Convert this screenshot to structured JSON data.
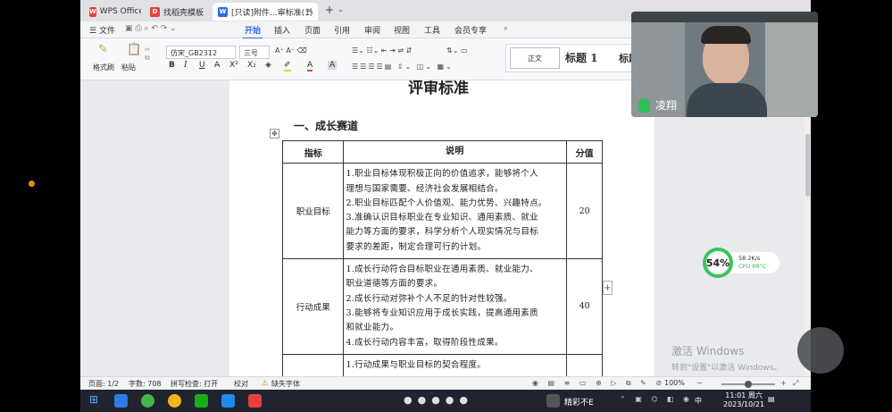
{
  "tabs": [
    {
      "label": "WPS Office",
      "icon": "wps-icon"
    },
    {
      "label": "找稻壳模板",
      "icon": "docer-icon"
    },
    {
      "label": "[只读]附件...审标准(1)",
      "icon": "word-doc-icon"
    }
  ],
  "add_tab": "+",
  "menu": {
    "file": "文件",
    "items": [
      "开始",
      "插入",
      "页面",
      "引用",
      "审阅",
      "视图",
      "工具",
      "会员专享"
    ],
    "active": "开始"
  },
  "ribbon": {
    "format_painter": "格式刷",
    "paste": "粘贴",
    "font_name": "仿宋_GB2312",
    "font_size": "三号",
    "styles": {
      "normal": "正文",
      "heading1": "标题 1",
      "heading2": "标题"
    }
  },
  "document": {
    "title": "评审标准",
    "section": "一、成长赛道",
    "table": {
      "headers": [
        "指标",
        "说明",
        "分值"
      ],
      "rows": [
        {
          "indicator": "职业目标",
          "lines": [
            "1.职业目标体现积极正向的价值追求，能够将个人",
            "理想与国家需要、经济社会发展相结合。",
            "2.职业目标匹配个人价值观、能力优势、兴趣特点。",
            "3.准确认识目标职业在专业知识、通用素质、就业",
            "能力等方面的要求，科学分析个人现实情况与目标",
            "要求的差距，制定合理可行的计划。"
          ],
          "score": "20"
        },
        {
          "indicator": "行动成果",
          "lines": [
            "1.成长行动符合目标职业在通用素质、就业能力、",
            "职业道德等方面的要求。",
            "2.成长行动对弥补个人不足的针对性较强。",
            "3.能够将专业知识应用于成长实践，提高通用素质",
            "和就业能力。",
            "4.成长行动内容丰富，取得阶段性成果。"
          ],
          "score": "40"
        },
        {
          "indicator": "",
          "lines": [
            "1.行动成果与职业目标的契合程度。"
          ],
          "score": ""
        }
      ]
    }
  },
  "status_bar": {
    "page": "页面: 1/2",
    "words": "字数: 708",
    "spell": "拼写检查: 打开",
    "proof": "校对",
    "missing_font": "缺失字体",
    "zoom": "100%"
  },
  "video": {
    "speaker": "凌翔"
  },
  "perf": {
    "percent": "54%",
    "net": "58.2K/s",
    "cpu": "CPU 88°C"
  },
  "watermark": {
    "line1": "激活 Windows",
    "line2": "转到\"设置\"以激活 Windows。"
  },
  "taskbar": {
    "app_label": "精彩不E",
    "time": "11:01 周六",
    "date": "2023/10/21",
    "ime": "中"
  },
  "colors": {
    "accent": "#2b6de5",
    "wps_red": "#e8413b",
    "mic_green": "#2fbf55",
    "perf_green": "#3cc45a"
  }
}
